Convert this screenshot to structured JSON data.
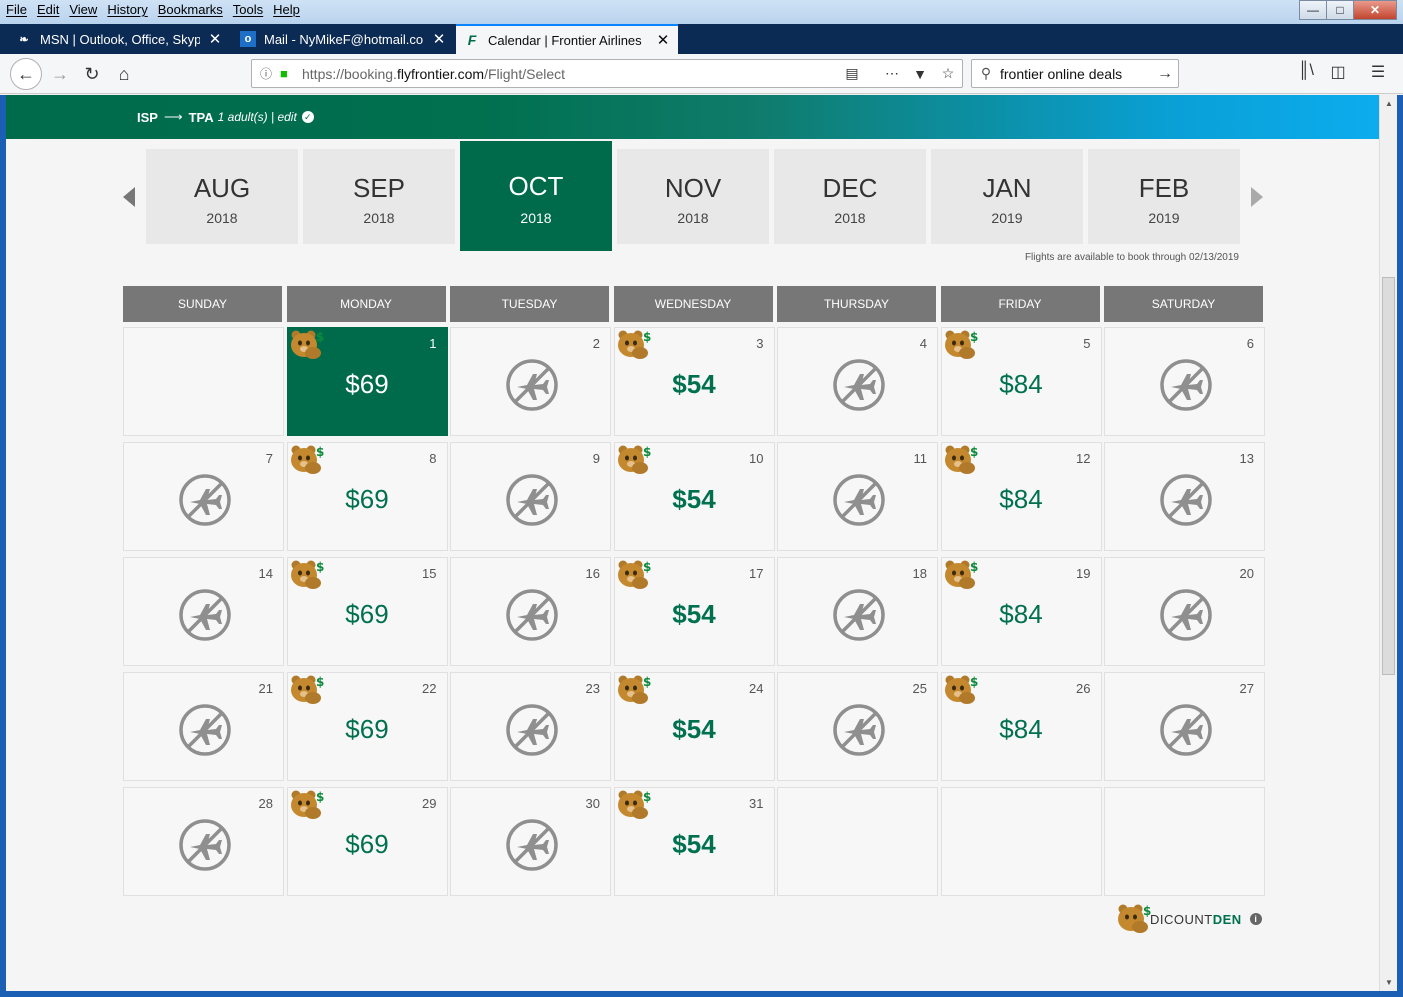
{
  "menu": [
    "File",
    "Edit",
    "View",
    "History",
    "Bookmarks",
    "Tools",
    "Help"
  ],
  "window_controls": {
    "minimize": "—",
    "maximize": "□",
    "close": "✕"
  },
  "tabs": [
    {
      "title": "MSN | Outlook, Office, Skype, E",
      "icon": "msn-icon"
    },
    {
      "title": "Mail - NyMikeF@hotmail.com",
      "icon": "outlook-icon"
    },
    {
      "title": "Calendar | Frontier Airlines",
      "icon": "frontier-icon"
    }
  ],
  "url": {
    "prefix": "https://booking.",
    "host": "flyfrontier.com",
    "path": "/Flight/Select"
  },
  "search": {
    "value": "frontier online deals"
  },
  "route": {
    "origin": "ISP",
    "arrow": "⟶",
    "destination": "TPA",
    "passengers": "1 adult(s) | edit"
  },
  "months": [
    {
      "month": "AUG",
      "year": "2018"
    },
    {
      "month": "SEP",
      "year": "2018"
    },
    {
      "month": "OCT",
      "year": "2018",
      "selected": true
    },
    {
      "month": "NOV",
      "year": "2018"
    },
    {
      "month": "DEC",
      "year": "2018"
    },
    {
      "month": "JAN",
      "year": "2019"
    },
    {
      "month": "FEB",
      "year": "2019"
    }
  ],
  "availability_note": "Flights are available to book through 02/13/2019",
  "weekdays": [
    "SUNDAY",
    "MONDAY",
    "TUESDAY",
    "WEDNESDAY",
    "THURSDAY",
    "FRIDAY",
    "SATURDAY"
  ],
  "calendar": {
    "first_weekday": 1,
    "days_in_month": 31,
    "selected_day": 1,
    "days": {
      "1": "$69",
      "3": "$54",
      "5": "$84",
      "8": "$69",
      "10": "$54",
      "12": "$84",
      "15": "$69",
      "17": "$54",
      "19": "$84",
      "22": "$69",
      "24": "$54",
      "26": "$84",
      "29": "$69",
      "31": "$54"
    },
    "discount_weekdays": [
      1,
      3,
      5
    ],
    "bold_weekdays": [
      3
    ]
  },
  "footer_logo": {
    "prefix": "DI",
    "text": "COUNT",
    "bold": "DEN"
  },
  "colors": {
    "brand_green": "#006b4b",
    "price_green": "#00704f",
    "header_gray": "#777777"
  }
}
